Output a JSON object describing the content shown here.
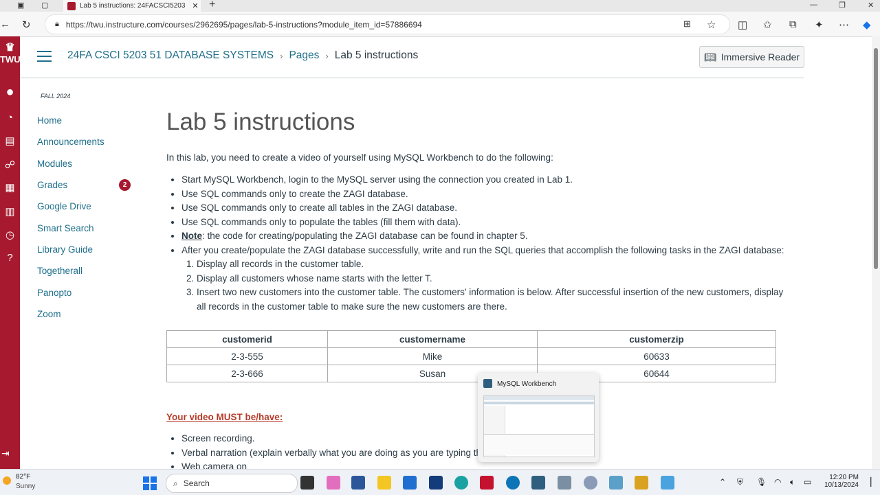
{
  "browser": {
    "tab_title": "Lab 5 instructions: 24FACSCI5203",
    "url": "https://twu.instructure.com/courses/2962695/pages/lab-5-instructions?module_item_id=57886694",
    "icons": [
      "back-icon",
      "refresh-icon",
      "lock-icon",
      "tabs-icon",
      "favorites-star-icon",
      "split-screen-icon",
      "collections-icon",
      "extensions-icon",
      "copilot-icon"
    ]
  },
  "global_nav": {
    "logo": "TWU",
    "accent": "#a6192e",
    "icons": [
      "account-icon",
      "dashboard-icon",
      "courses-icon",
      "groups-icon",
      "calendar-icon",
      "inbox-icon",
      "history-icon",
      "help-icon",
      "collapse-icon"
    ]
  },
  "header": {
    "breadcrumbs": [
      "24FA CSCI 5203 51 DATABASE SYSTEMS",
      "Pages",
      "Lab 5 instructions"
    ],
    "immersive_reader": "Immersive Reader"
  },
  "course_nav": {
    "term": "FALL 2024",
    "items": [
      {
        "label": "Home"
      },
      {
        "label": "Announcements"
      },
      {
        "label": "Modules"
      },
      {
        "label": "Grades",
        "badge": "2"
      },
      {
        "label": "Google Drive"
      },
      {
        "label": "Smart Search"
      },
      {
        "label": "Library Guide"
      },
      {
        "label": "Togetherall"
      },
      {
        "label": "Panopto"
      },
      {
        "label": "Zoom"
      }
    ]
  },
  "page": {
    "title": "Lab 5 instructions",
    "intro": "In this lab, you need to create a video of yourself using MySQL Workbench to do the following:",
    "bullets": [
      "Start MySQL Workbench, login to the MySQL server using the connection you created in Lab 1.",
      "Use SQL commands only to create the ZAGI database.",
      "Use SQL commands only to create all tables in the ZAGI database.",
      "Use SQL commands only to populate the tables (fill them with data)."
    ],
    "note_label": "Note",
    "note_text": ": the code for creating/populating the ZAGI database can be found in chapter 5.",
    "after_text": "After you create/populate the ZAGI database successfully, write and run the SQL queries that accomplish the following tasks in the ZAGI database:",
    "tasks": [
      "Display all records in the customer table.",
      "Display all customers whose name starts with the letter T.",
      "Insert two new customers into the customer table. The customers' information is below.  After successful insertion of the new customers, display all records in the customer table to make sure the new customers are there."
    ],
    "table": {
      "headers": [
        "customerid",
        "customername",
        "customerzip"
      ],
      "rows": [
        [
          "2-3-555",
          "Mike",
          "60633"
        ],
        [
          "2-3-666",
          "Susan",
          "60644"
        ]
      ]
    },
    "must_heading": "Your video MUST be/have:",
    "requirements": [
      "Screen recording.",
      "Verbal narration (explain verbally what you are doing as you are typing th",
      "Web camera on"
    ]
  },
  "popup": {
    "app_title": "MySQL Workbench"
  },
  "taskbar": {
    "temperature": "82°F",
    "condition": "Sunny",
    "search_placeholder": "Search",
    "time": "12:20 PM",
    "date": "10/13/2024"
  }
}
